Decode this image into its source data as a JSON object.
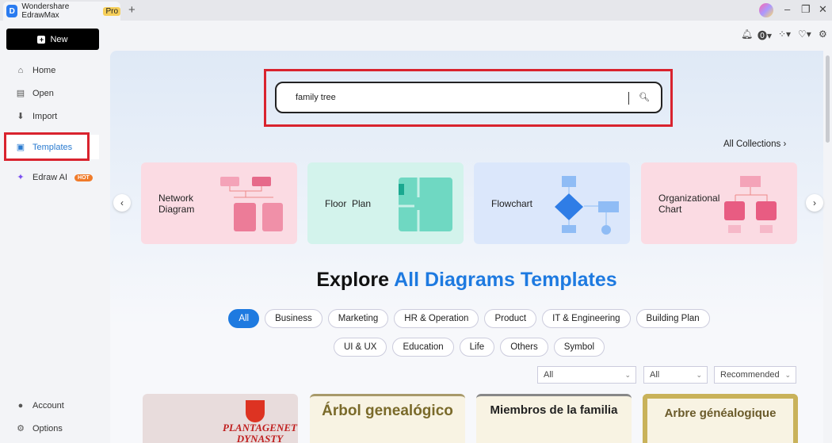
{
  "titlebar": {
    "app_name": "Wondershare EdrawMax",
    "badge": "Pro",
    "new_tab": "+"
  },
  "sidebar": {
    "new_label": "New",
    "items": [
      {
        "label": "Home",
        "icon": "home-icon"
      },
      {
        "label": "Open",
        "icon": "file-icon"
      },
      {
        "label": "Import",
        "icon": "import-icon"
      },
      {
        "label": "Templates",
        "icon": "templates-icon"
      },
      {
        "label": "Edraw AI",
        "icon": "ai-icon",
        "badge": "HOT"
      }
    ],
    "bottom": [
      {
        "label": "Account"
      },
      {
        "label": "Options"
      }
    ]
  },
  "search": {
    "value": "family tree"
  },
  "all_collections": "All Collections",
  "cards": [
    {
      "label": "Network Diagram",
      "bg": "#fbdbe3"
    },
    {
      "label": "Floor  Plan",
      "bg": "#d3f3ec"
    },
    {
      "label": "Flowchart",
      "bg": "#dbe7fb"
    },
    {
      "label": "Organizational Chart",
      "bg": "#fbdbe3"
    }
  ],
  "heading": {
    "prefix": "Explore ",
    "highlight": "All Diagrams Templates"
  },
  "chips_row1": [
    "All",
    "Business",
    "Marketing",
    "HR & Operation",
    "Product",
    "IT & Engineering",
    "Building Plan"
  ],
  "chips_row2": [
    "UI & UX",
    "Education",
    "Life",
    "Others",
    "Symbol"
  ],
  "filters": [
    "All",
    "All",
    "Recommended"
  ],
  "templates": [
    {
      "title": "PLANTAGENET DYNASTY"
    },
    {
      "title": "Árbol genealógico"
    },
    {
      "title": "Miembros de la familia"
    },
    {
      "title": "Arbre généalogique"
    }
  ],
  "accent": "#1e7ae0"
}
